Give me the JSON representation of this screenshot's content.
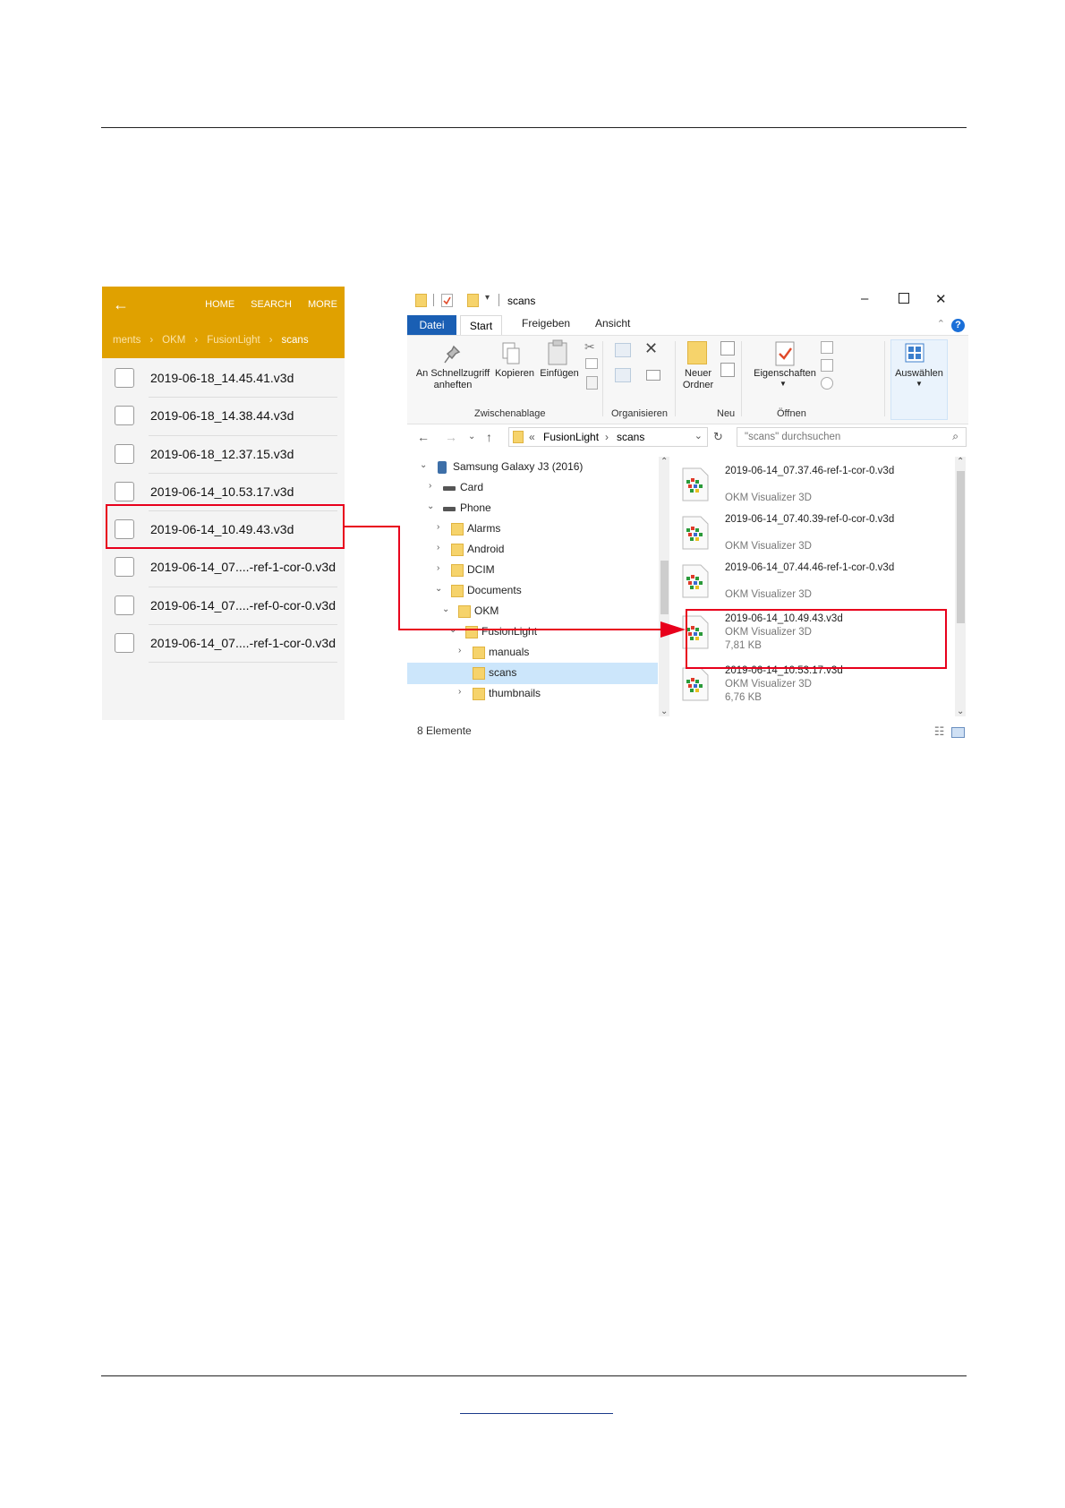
{
  "phone": {
    "back": "←",
    "nav": [
      "HOME",
      "SEARCH",
      "MORE"
    ],
    "crumbs": [
      "ments",
      "OKM",
      "FusionLight",
      "scans"
    ],
    "files": [
      "2019-06-18_14.45.41.v3d",
      "2019-06-18_14.38.44.v3d",
      "2019-06-18_12.37.15.v3d",
      "2019-06-14_10.53.17.v3d",
      "2019-06-14_10.49.43.v3d",
      "2019-06-14_07....-ref-1-cor-0.v3d",
      "2019-06-14_07....-ref-0-cor-0.v3d",
      "2019-06-14_07....-ref-1-cor-0.v3d"
    ]
  },
  "explorer": {
    "title": "scans",
    "tabs": {
      "datei": "Datei",
      "start": "Start",
      "freigeben": "Freigeben",
      "ansicht": "Ansicht"
    },
    "help": "?",
    "ribbon": {
      "pin": "An Schnellzugriff anheften",
      "copy": "Kopieren",
      "paste": "Einfügen",
      "new_folder": "Neuer Ordner",
      "properties": "Eigenschaften",
      "select": "Auswählen",
      "groups": {
        "clipboard": "Zwischenablage",
        "organize": "Organisieren",
        "new": "Neu",
        "open": "Öffnen"
      }
    },
    "address": {
      "prefix": "«",
      "parts": [
        "FusionLight",
        "scans"
      ]
    },
    "search_placeholder": "\"scans\" durchsuchen",
    "tree": [
      {
        "label": "Samsung Galaxy J3 (2016)"
      },
      {
        "label": "Card"
      },
      {
        "label": "Phone"
      },
      {
        "label": "Alarms"
      },
      {
        "label": "Android"
      },
      {
        "label": "DCIM"
      },
      {
        "label": "Documents"
      },
      {
        "label": "OKM"
      },
      {
        "label": "FusionLight"
      },
      {
        "label": "manuals"
      },
      {
        "label": "scans"
      },
      {
        "label": "thumbnails"
      }
    ],
    "files": [
      {
        "name": "2019-06-14_07.37.46-ref-1-cor-0.v3d",
        "type": "OKM Visualizer 3D",
        "size": ""
      },
      {
        "name": "2019-06-14_07.40.39-ref-0-cor-0.v3d",
        "type": "OKM Visualizer 3D",
        "size": ""
      },
      {
        "name": "2019-06-14_07.44.46-ref-1-cor-0.v3d",
        "type": "OKM Visualizer 3D",
        "size": ""
      },
      {
        "name": "2019-06-14_10.49.43.v3d",
        "type": "OKM Visualizer 3D",
        "size": "7,81 KB"
      },
      {
        "name": "2019-06-14_10.53.17.v3d",
        "type": "OKM Visualizer 3D",
        "size": "6,76 KB"
      }
    ],
    "status": "8 Elemente"
  },
  "colors": {
    "phone_bar": "#e0a100",
    "highlight": "#e8001c",
    "ribbon_blue": "#1a5fb4",
    "selection": "#cce6fb"
  }
}
